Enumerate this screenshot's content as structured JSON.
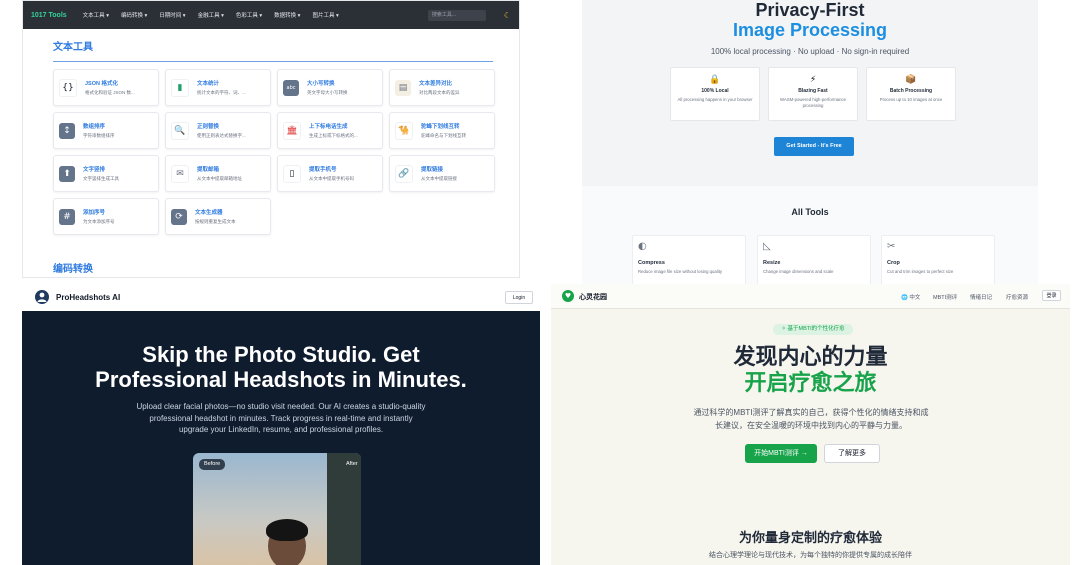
{
  "tools1017": {
    "logo": "1017 Tools",
    "menu": [
      "文本工具 ▾",
      "编码转换 ▾",
      "日期时间 ▾",
      "金融工具 ▾",
      "色彩工具 ▾",
      "数据转换 ▾",
      "图片工具 ▾"
    ],
    "search_placeholder": "搜索工具...",
    "theme_icon": "☾",
    "heading": "文本工具",
    "cards": [
      {
        "icon": "{}",
        "icon_name": "braces-icon",
        "icon_bg": "#ffffff",
        "icon_color": "#111827",
        "title": "JSON 格式化",
        "desc": "格式化和验证 JSON 数..."
      },
      {
        "icon": "▮",
        "icon_name": "bar-chart-icon",
        "icon_bg": "#ffffff",
        "icon_color": "#22a06b",
        "title": "文本统计",
        "desc": "统计文本的字符、词、..."
      },
      {
        "icon": "abc",
        "icon_name": "abc-icon",
        "icon_bg": "#64748b",
        "icon_color": "#ffffff",
        "title": "大小写转换",
        "desc": "英文字母大小写转换"
      },
      {
        "icon": "▤",
        "icon_name": "compare-icon",
        "icon_bg": "#f3efe3",
        "icon_color": "#6b7280",
        "title": "文本差异对比",
        "desc": "对比两段文本的差异"
      },
      {
        "icon": "↕",
        "icon_name": "sort-icon",
        "icon_bg": "#64748b",
        "icon_color": "#ffffff",
        "title": "数组排序",
        "desc": "字符串数组排序"
      },
      {
        "icon": "🔍",
        "icon_name": "magnifier-icon",
        "icon_bg": "#ffffff",
        "icon_color": "#111827",
        "title": "正则替换",
        "desc": "使用正则表达式替换字..."
      },
      {
        "icon": "🏛",
        "icon_name": "building-icon",
        "icon_bg": "#ffffff",
        "icon_color": "#dc2626",
        "title": "上下标电话生成",
        "desc": "生成上标或下标格式的..."
      },
      {
        "icon": "🐪",
        "icon_name": "camel-icon",
        "icon_bg": "#ffffff",
        "icon_color": "#b7791f",
        "title": "驼峰下划线互转",
        "desc": "驼峰命名与下划线互转"
      },
      {
        "icon": "⬆",
        "icon_name": "arrow-up-icon",
        "icon_bg": "#64748b",
        "icon_color": "#ffffff",
        "title": "文字竖排",
        "desc": "文字竖排生成工具"
      },
      {
        "icon": "✉",
        "icon_name": "envelope-icon",
        "icon_bg": "#ffffff",
        "icon_color": "#6b7280",
        "title": "提取邮箱",
        "desc": "从文本中提取邮箱地址"
      },
      {
        "icon": "▯",
        "icon_name": "phone-icon",
        "icon_bg": "#ffffff",
        "icon_color": "#111827",
        "title": "提取手机号",
        "desc": "从文本中提取手机号码"
      },
      {
        "icon": "🔗",
        "icon_name": "link-icon",
        "icon_bg": "#ffffff",
        "icon_color": "#6b7280",
        "title": "提取链接",
        "desc": "从文本中提取链接"
      },
      {
        "icon": "#",
        "icon_name": "numbering-icon",
        "icon_bg": "#64748b",
        "icon_color": "#ffffff",
        "title": "添加序号",
        "desc": "为文本添加序号"
      },
      {
        "icon": "⟳",
        "icon_name": "refresh-icon",
        "icon_bg": "#64748b",
        "icon_color": "#ffffff",
        "title": "文本生成器",
        "desc": "按规则重复生成文本"
      }
    ],
    "heading2": "编码转换"
  },
  "privacy": {
    "title_line1": "Privacy-First",
    "title_line2": "Image Processing",
    "subtitle": "100% local processing · No upload · No sign-in required",
    "features": [
      {
        "icon": "🔒",
        "icon_name": "lock-icon",
        "title": "100% Local",
        "desc": "All processing happens in your browser"
      },
      {
        "icon": "⚡",
        "icon_name": "lightning-icon",
        "title": "Blazing Fast",
        "desc": "WASM-powered high-performance processing"
      },
      {
        "icon": "📦",
        "icon_name": "box-icon",
        "title": "Batch Processing",
        "desc": "Process up to 10 images at once"
      }
    ],
    "cta": "Get Started - It's Free",
    "all_tools": "All Tools",
    "tools": [
      {
        "icon": "◐",
        "icon_name": "compress-icon",
        "name": "Compress",
        "desc": "Reduce image file size without losing quality"
      },
      {
        "icon": "◺",
        "icon_name": "resize-icon",
        "name": "Resize",
        "desc": "Change image dimensions and scale"
      },
      {
        "icon": "✂",
        "icon_name": "scissors-icon",
        "name": "Crop",
        "desc": "Cut and trim images to perfect size"
      }
    ]
  },
  "headshots": {
    "brand": "ProHeadshots AI",
    "login": "Login",
    "title_line1": "Skip the Photo Studio. Get",
    "title_line2": "Professional Headshots in Minutes.",
    "subtitle": "Upload clear facial photos—no studio visit needed. Our AI creates a studio-quality professional headshot in minutes. Track progress in real-time and instantly upgrade your LinkedIn, resume, and professional profiles.",
    "before_label": "Before",
    "after_label": "After"
  },
  "garden": {
    "brand": "心灵花园",
    "lang": "🌐 中文",
    "menu": [
      "MBTI测评",
      "情绪日记",
      "疗愈资源"
    ],
    "login": "登录",
    "badge": "✧ 基于MBTI的个性化疗愈",
    "title_line1": "发现内心的力量",
    "title_line2": "开启疗愈之旅",
    "subtitle": "通过科学的MBTI测评了解真实的自己，获得个性化的情绪支持和成长建议，在安全温暖的环境中找到内心的平静与力量。",
    "primary_btn": "开始MBTI测评 →",
    "secondary_btn": "了解更多",
    "section_title": "为你量身定制的疗愈体验",
    "section_sub": "结合心理学理论与现代技术，为每个独特的你提供专属的成长陪伴"
  }
}
